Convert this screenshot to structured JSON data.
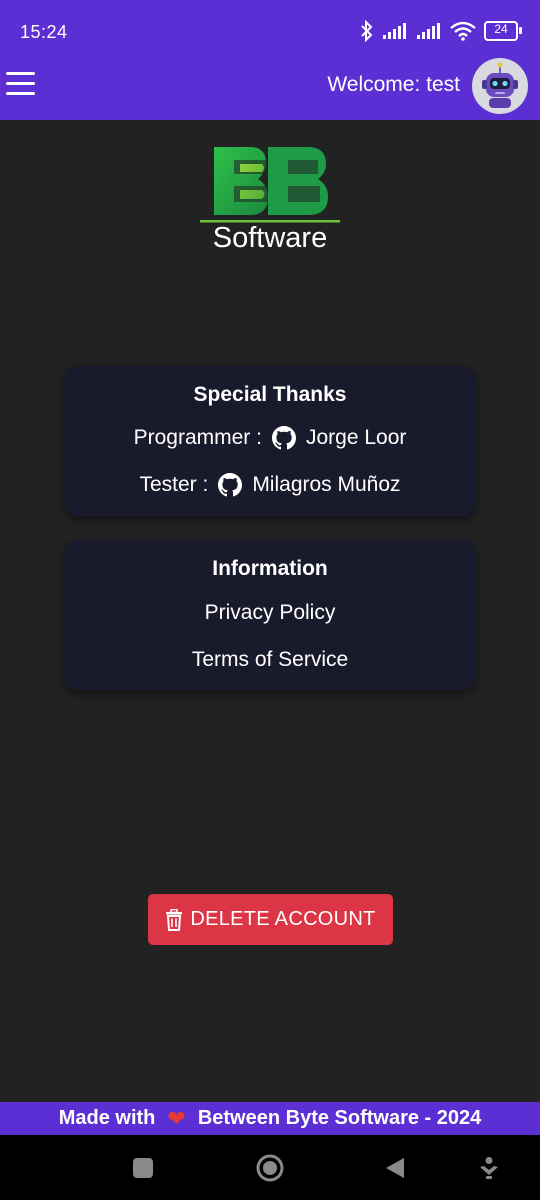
{
  "status_bar": {
    "time": "15:24",
    "battery": "24"
  },
  "header": {
    "welcome": "Welcome: test"
  },
  "logo": {
    "text": "Software",
    "mark": "BB"
  },
  "special_thanks": {
    "title": "Special Thanks",
    "programmer_label": "Programmer :",
    "programmer_name": "Jorge Loor",
    "tester_label": "Tester :",
    "tester_name": "Milagros Muñoz"
  },
  "information": {
    "title": "Information",
    "privacy": "Privacy Policy",
    "terms": "Terms of Service"
  },
  "actions": {
    "delete": "DELETE ACCOUNT"
  },
  "footer": {
    "made_with": "Made with",
    "company": "Between Byte Software - 2024"
  },
  "colors": {
    "primary": "#5b2fd3",
    "background": "#222222",
    "card": "#191a2c",
    "danger": "#dc3545",
    "heart": "#e53935"
  },
  "icons": [
    "bluetooth-icon",
    "signal-icon",
    "wifi-icon",
    "battery-icon",
    "menu-icon",
    "robot-avatar",
    "github-icon",
    "trash-icon",
    "heart-icon",
    "square-icon",
    "circle-icon",
    "back-triangle-icon",
    "download-icon"
  ]
}
